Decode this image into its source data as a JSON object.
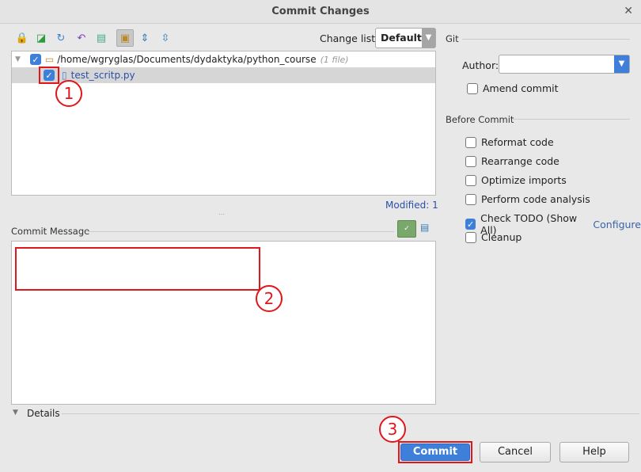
{
  "window": {
    "title": "Commit Changes"
  },
  "toolbar": {
    "icons": [
      "lock-icon",
      "diff-icon",
      "refresh-icon",
      "rollback-icon",
      "edit-icon",
      "group-icon",
      "expand-all-icon",
      "collapse-all-icon"
    ],
    "changelist_label": "Change list:",
    "changelist_value": "Default"
  },
  "tree": {
    "root_path": "/home/wgryglas/Documents/dydaktyka/python_course",
    "root_count": "(1 file)",
    "root_checked": true,
    "file": "test_scritp.py",
    "file_checked": true
  },
  "modified": "Modified: 1",
  "commit_message": {
    "label": "Commit Message",
    "value": ""
  },
  "details_label": "Details",
  "git": {
    "section": "Git",
    "author_label": "Author:",
    "author_value": "",
    "amend_label": "Amend commit",
    "amend_checked": false
  },
  "before_commit": {
    "section": "Before Commit",
    "options": [
      {
        "label": "Reformat code",
        "checked": false
      },
      {
        "label": "Rearrange code",
        "checked": false
      },
      {
        "label": "Optimize imports",
        "checked": false
      },
      {
        "label": "Perform code analysis",
        "checked": false
      },
      {
        "label": "Check TODO (Show All)",
        "checked": true
      },
      {
        "label": "Cleanup",
        "checked": false
      }
    ],
    "configure_link": "Configure"
  },
  "annotations": [
    "1",
    "2",
    "3"
  ],
  "buttons": {
    "commit": "Commit",
    "cancel": "Cancel",
    "help": "Help"
  },
  "colors": {
    "accent": "#3d7fd9",
    "annotation": "#e0161b"
  }
}
